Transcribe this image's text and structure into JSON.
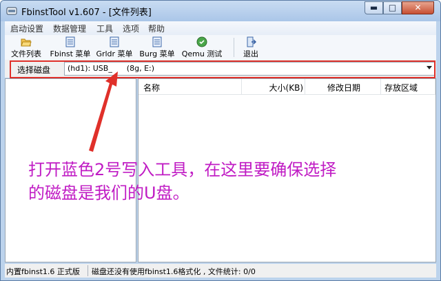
{
  "window": {
    "title": "FbinstTool v1.607 - [文件列表]",
    "controls": {
      "minimize": "▬",
      "maximize": "□",
      "close": "✕"
    }
  },
  "menu": [
    "启动设置",
    "数据管理",
    "工具",
    "选项",
    "帮助"
  ],
  "toolbar": [
    {
      "label": "文件列表",
      "icon": "folder-open-icon"
    },
    {
      "label": "Fbinst 菜单",
      "icon": "document-icon"
    },
    {
      "label": "Grldr 菜单",
      "icon": "document-icon"
    },
    {
      "label": "Burg 菜单",
      "icon": "document-icon"
    },
    {
      "label": "Qemu 测试",
      "icon": "qemu-globe-icon"
    },
    {
      "label": "退出",
      "icon": "exit-door-icon"
    }
  ],
  "disk": {
    "label": "选择磁盘",
    "selected": "(hd1): USB_      (8g, E:)"
  },
  "file_table": {
    "columns": [
      "名称",
      "大小(KB)",
      "修改日期",
      "存放区域"
    ]
  },
  "annotation": {
    "line1": "打开蓝色2号写入工具，在这里要确保选择",
    "line2": "的磁盘是我们的U盘。",
    "color": "#c01cc4",
    "highlight_color": "#e0302a"
  },
  "status": {
    "left": "内置fbinst1.6 正式版",
    "right": "磁盘还没有使用fbinst1.6格式化 , 文件统计: 0/0"
  }
}
